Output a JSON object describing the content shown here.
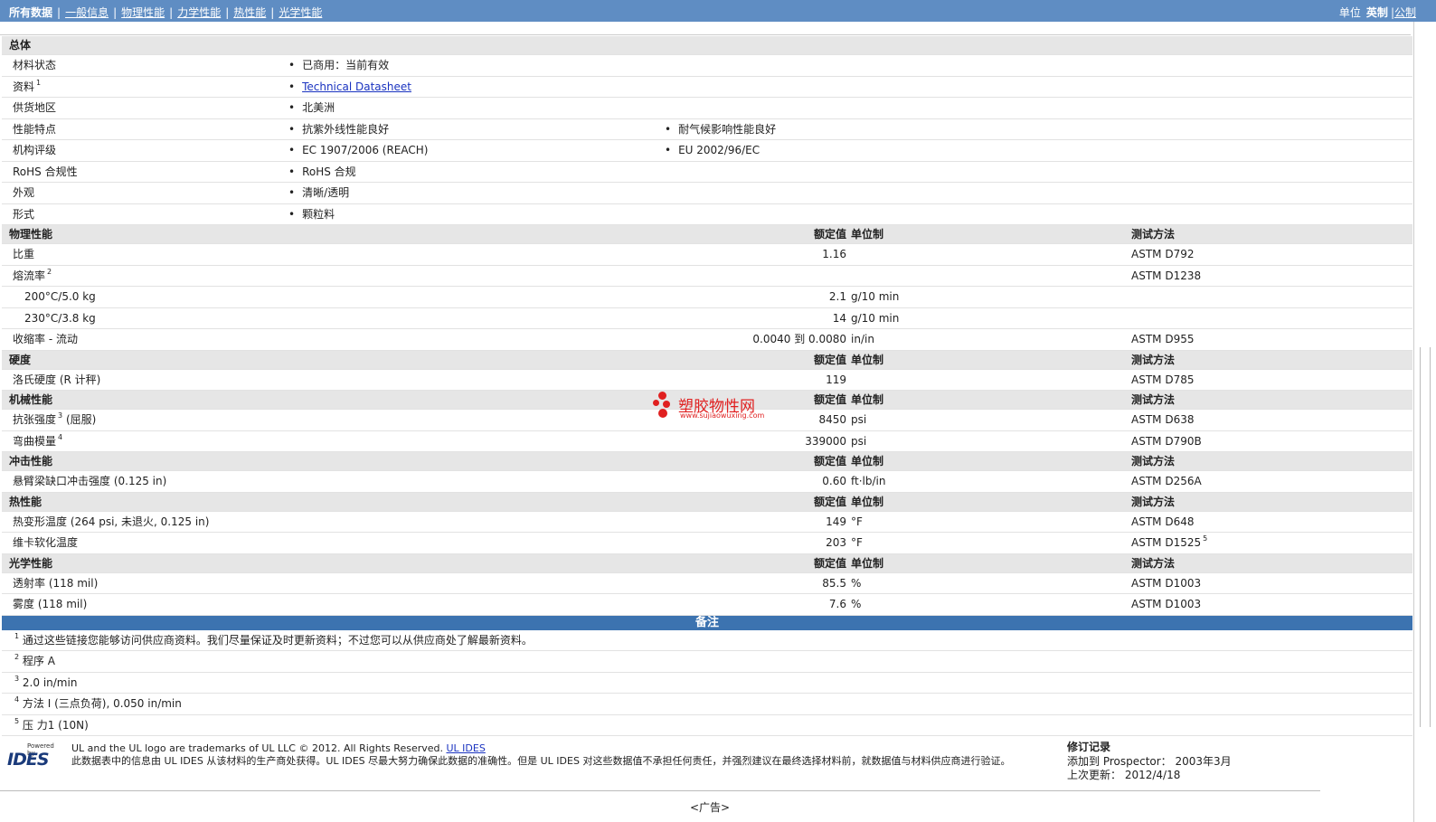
{
  "nav": {
    "current": "所有数据",
    "tabs": [
      "一般信息",
      "物理性能",
      "力学性能",
      "热性能",
      "光学性能"
    ],
    "units_label": "单位",
    "units_current": "英制",
    "units_other": "公制"
  },
  "general": {
    "title": "总体",
    "rows": [
      {
        "label": "材料状态",
        "v1": "已商用：当前有效"
      },
      {
        "label": "资料",
        "note": "1",
        "v1": "Technical Datasheet"
      },
      {
        "label": "供货地区",
        "v1": "北美洲"
      },
      {
        "label": "性能特点",
        "v1": "抗紫外线性能良好",
        "v2": "耐气候影响性能良好"
      },
      {
        "label": "机构评级",
        "v1": "EC 1907/2006 (REACH)",
        "v2": "EU 2002/96/EC"
      },
      {
        "label": "RoHS 合规性",
        "v1": "RoHS 合规"
      },
      {
        "label": "外观",
        "v1": "清晰/透明"
      },
      {
        "label": "形式",
        "v1": "颗粒料"
      }
    ]
  },
  "headers": {
    "value": "额定值",
    "unit": "单位制",
    "method": "测试方法"
  },
  "physical": {
    "title": "物理性能",
    "rows": [
      {
        "label": "比重",
        "value": "1.16",
        "unit": "",
        "method": "ASTM D792"
      },
      {
        "label": "熔流率",
        "note": "2",
        "value": "",
        "unit": "",
        "method": "ASTM D1238"
      },
      {
        "label": "200°C/5.0 kg",
        "value": "2.1",
        "unit": "g/10 min",
        "method": ""
      },
      {
        "label": "230°C/3.8 kg",
        "value": "14",
        "unit": "g/10 min",
        "method": ""
      },
      {
        "label": "收缩率 - 流动",
        "value": "0.0040 到 0.0080",
        "unit": "in/in",
        "method": "ASTM D955"
      }
    ]
  },
  "hardness": {
    "title": "硬度",
    "rows": [
      {
        "label": "洛氏硬度 (R 计秤)",
        "value": "119",
        "unit": "",
        "method": "ASTM D785"
      }
    ]
  },
  "mechanical": {
    "title": "机械性能",
    "rows": [
      {
        "label": "抗张强度",
        "note": "3",
        "suffix": "(屈服)",
        "value": "8450",
        "unit": "psi",
        "method": "ASTM D638"
      },
      {
        "label": "弯曲模量",
        "note": "4",
        "value": "339000",
        "unit": "psi",
        "method": "ASTM D790B"
      }
    ]
  },
  "impact": {
    "title": "冲击性能",
    "rows": [
      {
        "label": "悬臂梁缺口冲击强度 (0.125 in)",
        "value": "0.60",
        "unit": "ft·lb/in",
        "method": "ASTM D256A"
      }
    ]
  },
  "thermal": {
    "title": "热性能",
    "rows": [
      {
        "label": "热变形温度 (264 psi, 未退火, 0.125 in)",
        "value": "149",
        "unit": "°F",
        "method": "ASTM D648"
      },
      {
        "label": "维卡软化温度",
        "value": "203",
        "unit": "°F",
        "method": "ASTM D1525",
        "method_note": "5"
      }
    ]
  },
  "optical": {
    "title": "光学性能",
    "rows": [
      {
        "label": "透射率 (118 mil)",
        "value": "85.5",
        "unit": "%",
        "method": "ASTM D1003"
      },
      {
        "label": "雾度 (118 mil)",
        "value": "7.6",
        "unit": "%",
        "method": "ASTM D1003"
      }
    ]
  },
  "notes": {
    "title": "备注",
    "items": [
      {
        "n": "1",
        "text": "通过这些链接您能够访问供应商资料。我们尽量保证及时更新资料；不过您可以从供应商处了解最新资料。"
      },
      {
        "n": "2",
        "text": "程序 A"
      },
      {
        "n": "3",
        "text": "2.0 in/min"
      },
      {
        "n": "4",
        "text": "方法 I (三点负荷), 0.050 in/min"
      },
      {
        "n": "5",
        "text": "压 力1 (10N)"
      }
    ]
  },
  "watermark": {
    "title": "塑胶物性网",
    "url": "www.sujiaowuxing.com"
  },
  "footer": {
    "logo_small": "Powered by",
    "logo_text": "IDES",
    "line1": "UL and the UL logo are trademarks of UL LLC © 2012. All Rights Reserved.",
    "line1_link": "UL IDES",
    "line2": "此数据表中的信息由 UL IDES 从该材料的生产商处获得。UL IDES 尽最大努力确保此数据的准确性。但是 UL IDES 对这些数据值不承担任何责任，并强烈建议在最终选择材料前，就数据值与材料供应商进行验证。",
    "rev_title": "修订记录",
    "rev_added": "添加到 Prospector： 2003年3月",
    "rev_updated": "上次更新： 2012/4/18",
    "ad": "<广告>"
  },
  "colors": {
    "topbar": "#5f8dc3",
    "notes_bar": "#3c73b0",
    "section_bg": "#e6e6e6",
    "link": "#1a33c0",
    "watermark": "#e02020"
  }
}
